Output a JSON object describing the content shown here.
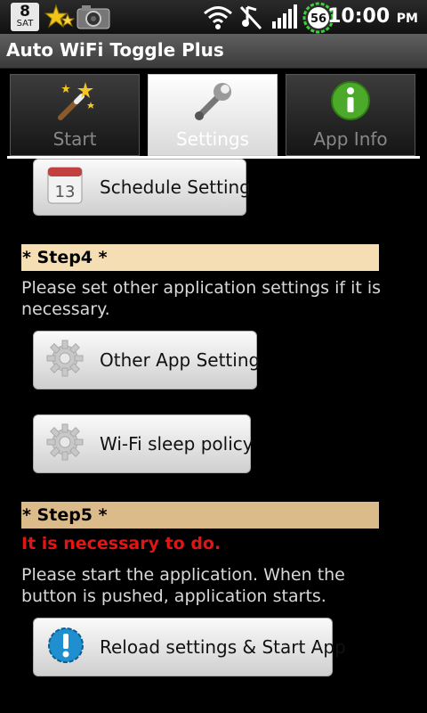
{
  "status_bar": {
    "date_day": "8",
    "date_weekday": "SAT",
    "battery_level": "56",
    "time": "10:00",
    "ampm": "PM",
    "icons": [
      "calendar-icon",
      "star-app-icon",
      "camera-icon",
      "wifi-icon",
      "mute-icon",
      "signal-icon",
      "battery-icon"
    ]
  },
  "app_title": "Auto WiFi Toggle Plus",
  "tabs": [
    {
      "label": "Start",
      "icon": "magic-wand-icon"
    },
    {
      "label": "Settings",
      "icon": "wrench-icon",
      "active": true
    },
    {
      "label": "App Info",
      "icon": "info-icon"
    }
  ],
  "content": {
    "schedule_button": "Schedule Setting",
    "step4": {
      "title": "* Step4 *",
      "description": "Please set other application settings if it is necessary.",
      "buttons": [
        "Other App Setting",
        "Wi-Fi sleep policy"
      ]
    },
    "step5": {
      "title": "* Step5 *",
      "warning": "It is necessary to do.",
      "description": "Please start the application. When the button is pushed, application starts.",
      "button": "Reload settings & Start App"
    }
  },
  "colors": {
    "step4_bg": "#f5deb3",
    "step5_bg": "#dcbb8a",
    "warning": "#e01515"
  }
}
